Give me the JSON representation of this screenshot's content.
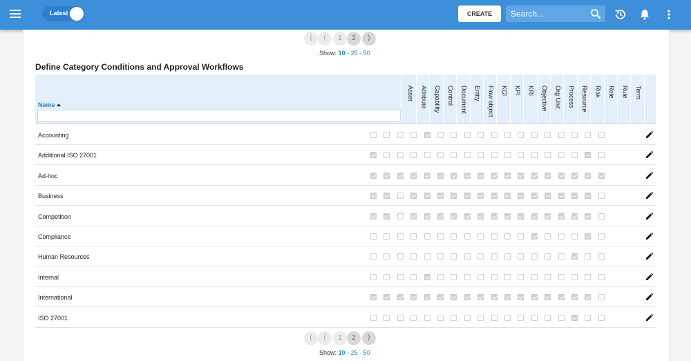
{
  "header": {
    "toggle_label": "Latest",
    "create_label": "CREATE",
    "search_placeholder": "Search..."
  },
  "pagination": {
    "pages": [
      "1",
      "2"
    ],
    "current_page": "2",
    "show_label": "Show:",
    "sizes": [
      "10",
      "25",
      "50"
    ],
    "current_size": "10"
  },
  "table": {
    "title": "Define Category Conditions and Approval Workflows",
    "name_header": "Name",
    "columns": [
      "Asset",
      "Attribute",
      "Capability",
      "Control",
      "Document",
      "Entity",
      "Flow object",
      "KCI",
      "KPI",
      "KRI",
      "Objective",
      "Org Unit",
      "Process",
      "Resource",
      "Risk",
      "Role",
      "Rule",
      "Term"
    ],
    "rows": [
      {
        "name": "Accounting",
        "checks": [
          0,
          0,
          0,
          0,
          1,
          0,
          0,
          0,
          0,
          0,
          0,
          0,
          0,
          0,
          0,
          0,
          0,
          0
        ]
      },
      {
        "name": "Additional ISO 27001",
        "checks": [
          1,
          0,
          0,
          0,
          0,
          0,
          0,
          0,
          0,
          0,
          0,
          0,
          0,
          0,
          0,
          0,
          1,
          0
        ]
      },
      {
        "name": "Ad-hoc",
        "checks": [
          1,
          1,
          1,
          1,
          1,
          1,
          1,
          1,
          1,
          1,
          1,
          1,
          1,
          1,
          1,
          1,
          1,
          1
        ]
      },
      {
        "name": "Business",
        "checks": [
          1,
          1,
          0,
          1,
          1,
          1,
          1,
          1,
          1,
          1,
          1,
          1,
          1,
          1,
          1,
          1,
          1,
          0
        ]
      },
      {
        "name": "Competition",
        "checks": [
          1,
          1,
          0,
          1,
          1,
          1,
          1,
          1,
          1,
          1,
          1,
          1,
          1,
          1,
          1,
          1,
          1,
          0
        ]
      },
      {
        "name": "Compliance",
        "checks": [
          0,
          0,
          0,
          0,
          0,
          0,
          0,
          0,
          0,
          0,
          0,
          0,
          1,
          0,
          0,
          0,
          1,
          0
        ]
      },
      {
        "name": "Human Resources",
        "checks": [
          0,
          0,
          0,
          0,
          0,
          0,
          0,
          0,
          0,
          0,
          0,
          0,
          0,
          0,
          0,
          1,
          0,
          0
        ]
      },
      {
        "name": "Internal",
        "checks": [
          0,
          0,
          0,
          0,
          1,
          0,
          0,
          0,
          0,
          0,
          0,
          0,
          0,
          0,
          0,
          0,
          0,
          0
        ]
      },
      {
        "name": "International",
        "checks": [
          1,
          1,
          1,
          1,
          1,
          1,
          1,
          1,
          1,
          1,
          1,
          1,
          1,
          1,
          1,
          1,
          1,
          0
        ]
      },
      {
        "name": "ISO 27001",
        "checks": [
          0,
          0,
          0,
          0,
          0,
          0,
          0,
          0,
          0,
          0,
          0,
          0,
          0,
          0,
          0,
          1,
          0,
          0
        ]
      }
    ]
  }
}
